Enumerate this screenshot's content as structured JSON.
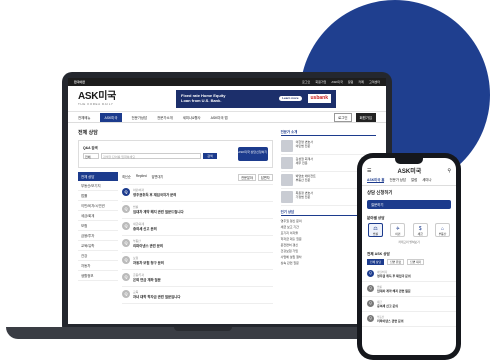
{
  "colors": {
    "accent": "#1c3b8d",
    "blob": "#1f3f8f"
  },
  "topbar": {
    "left": "한국어판",
    "right": [
      "로그인",
      "회원가입",
      "ASK미국",
      "칼럼",
      "카페",
      "고객센터"
    ]
  },
  "header": {
    "logo": "ASK미국",
    "logo_sub": "THE KOREA DAILY",
    "ad_line1": "Fixed rate Home Equity",
    "ad_line2": "Loan from U.S. Bank.",
    "ad_button": "Learn more",
    "ad_bank": "usbank"
  },
  "nav": {
    "items": [
      "전체메뉴",
      "ASK미국",
      "전문가상담",
      "전문가소개",
      "세미나&행사",
      "ASK미국 앱"
    ],
    "side": [
      "로그인",
      "회원가입"
    ]
  },
  "main": {
    "title": "전체 상담",
    "qa_label": "Q&A 검색",
    "select": "전체",
    "search_placeholder": "검색할 단어를 입력하세요",
    "search_button": "검색",
    "ask_button": "ASK미국 상담신청하기",
    "categories": [
      "전체 상담",
      "부동산/모기지",
      "법률",
      "이민/비자/시민권",
      "세금/회계",
      "보험",
      "금융/투자",
      "교육/유학",
      "건강",
      "자동차",
      "생활정보"
    ],
    "filters": [
      "최신순",
      "Replied",
      "답변대기"
    ],
    "filter_selects": [
      "전문분야",
      "답변자"
    ],
    "posts": [
      {
        "cat": "이민/비자",
        "title": "영주권취득 후 재입국허가 문의"
      },
      {
        "cat": "법률",
        "title": "임대차 계약 해지 관련 질문드립니다"
      },
      {
        "cat": "세금/회계",
        "title": "증여세 신고 문의"
      },
      {
        "cat": "부동산",
        "title": "리파이낸스 관련 문의"
      },
      {
        "cat": "보험",
        "title": "자동차 보험 청구 문의"
      },
      {
        "cat": "금융/투자",
        "title": "은퇴 연금 계좌 질문"
      },
      {
        "cat": "교육",
        "title": "자녀 대학 학자금 관련 질문입니다"
      }
    ]
  },
  "side": {
    "experts_title": "전문가 소개",
    "experts": [
      {
        "name": "이한영 변호사",
        "field": "이민법 전문"
      },
      {
        "name": "김성철 회계사",
        "field": "세무 전문"
      },
      {
        "name": "박영호 에이전트",
        "field": "부동산 전문"
      },
      {
        "name": "최윤정 변호사",
        "field": "가정법 전문"
      }
    ],
    "popular_title": "인기 상담",
    "popular": [
      "영주권 갱신 문의",
      "세금 보고 기간",
      "모기지 이자율",
      "학자금 대출 질문",
      "운전면허 갱신",
      "건강보험 가입",
      "사업체 설립 절차",
      "상속 관련 질문"
    ]
  },
  "phone": {
    "logo": "ASK미국",
    "tabs": [
      "ASK미국 홈",
      "전문가 상담",
      "칼럼",
      "세미나"
    ],
    "title": "상담 신청하기",
    "ask_button": "질문하기",
    "section": "분야별 상담",
    "icons": [
      {
        "icon": "⚖",
        "label": "법률"
      },
      {
        "icon": "✈",
        "label": "이민"
      },
      {
        "icon": "$",
        "label": "세금"
      },
      {
        "icon": "⌂",
        "label": "부동산"
      }
    ],
    "more": "카테고리 펼쳐보기",
    "list_title": "전체 ASK 상담",
    "list_tabs": [
      "전체 상담",
      "답변 완료",
      "답변 대기"
    ],
    "posts": [
      {
        "cat": "이민/비자",
        "title": "영주권 취득 후 재입국 문의"
      },
      {
        "cat": "법률",
        "title": "임대차 계약 해지 관련 질문"
      },
      {
        "cat": "세금",
        "title": "증여세 신고 문의"
      },
      {
        "cat": "부동산",
        "title": "리파이낸스 관련 문의"
      }
    ]
  }
}
